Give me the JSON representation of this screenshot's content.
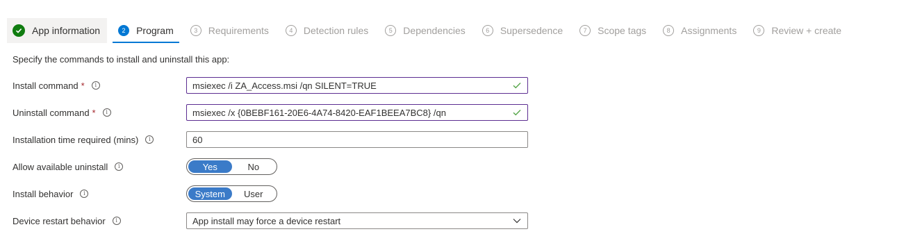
{
  "tabs": [
    {
      "number": "",
      "label": "App information",
      "state": "completed"
    },
    {
      "number": "2",
      "label": "Program",
      "state": "active"
    },
    {
      "number": "3",
      "label": "Requirements",
      "state": "pending"
    },
    {
      "number": "4",
      "label": "Detection rules",
      "state": "pending"
    },
    {
      "number": "5",
      "label": "Dependencies",
      "state": "pending"
    },
    {
      "number": "6",
      "label": "Supersedence",
      "state": "pending"
    },
    {
      "number": "7",
      "label": "Scope tags",
      "state": "pending"
    },
    {
      "number": "8",
      "label": "Assignments",
      "state": "pending"
    },
    {
      "number": "9",
      "label": "Review + create",
      "state": "pending"
    }
  ],
  "form": {
    "description": "Specify the commands to install and uninstall this app:",
    "install_command": {
      "label": "Install command",
      "required_mark": "*",
      "value": "msiexec /i ZA_Access.msi /qn SILENT=TRUE"
    },
    "uninstall_command": {
      "label": "Uninstall command",
      "required_mark": "*",
      "value": "msiexec /x {0BEBF161-20E6-4A74-8420-EAF1BEEA7BC8} /qn"
    },
    "install_time": {
      "label": "Installation time required (mins)",
      "value": "60"
    },
    "allow_uninstall": {
      "label": "Allow available uninstall",
      "options": [
        "Yes",
        "No"
      ],
      "selected": "Yes"
    },
    "install_behavior": {
      "label": "Install behavior",
      "options": [
        "System",
        "User"
      ],
      "selected": "System"
    },
    "restart_behavior": {
      "label": "Device restart behavior",
      "value": "App install may force a device restart"
    }
  },
  "icons": {
    "info": "i",
    "completed": "checkmark-circle-icon",
    "valid": "checkmark-icon",
    "dropdown": "chevron-down-icon"
  },
  "colors": {
    "accent": "#0078d4",
    "toggle_on": "#3b7bc8",
    "success": "#107c10",
    "valid_check": "#57a64a",
    "field_border_valid": "#5c2d91",
    "required": "#a4262c"
  }
}
